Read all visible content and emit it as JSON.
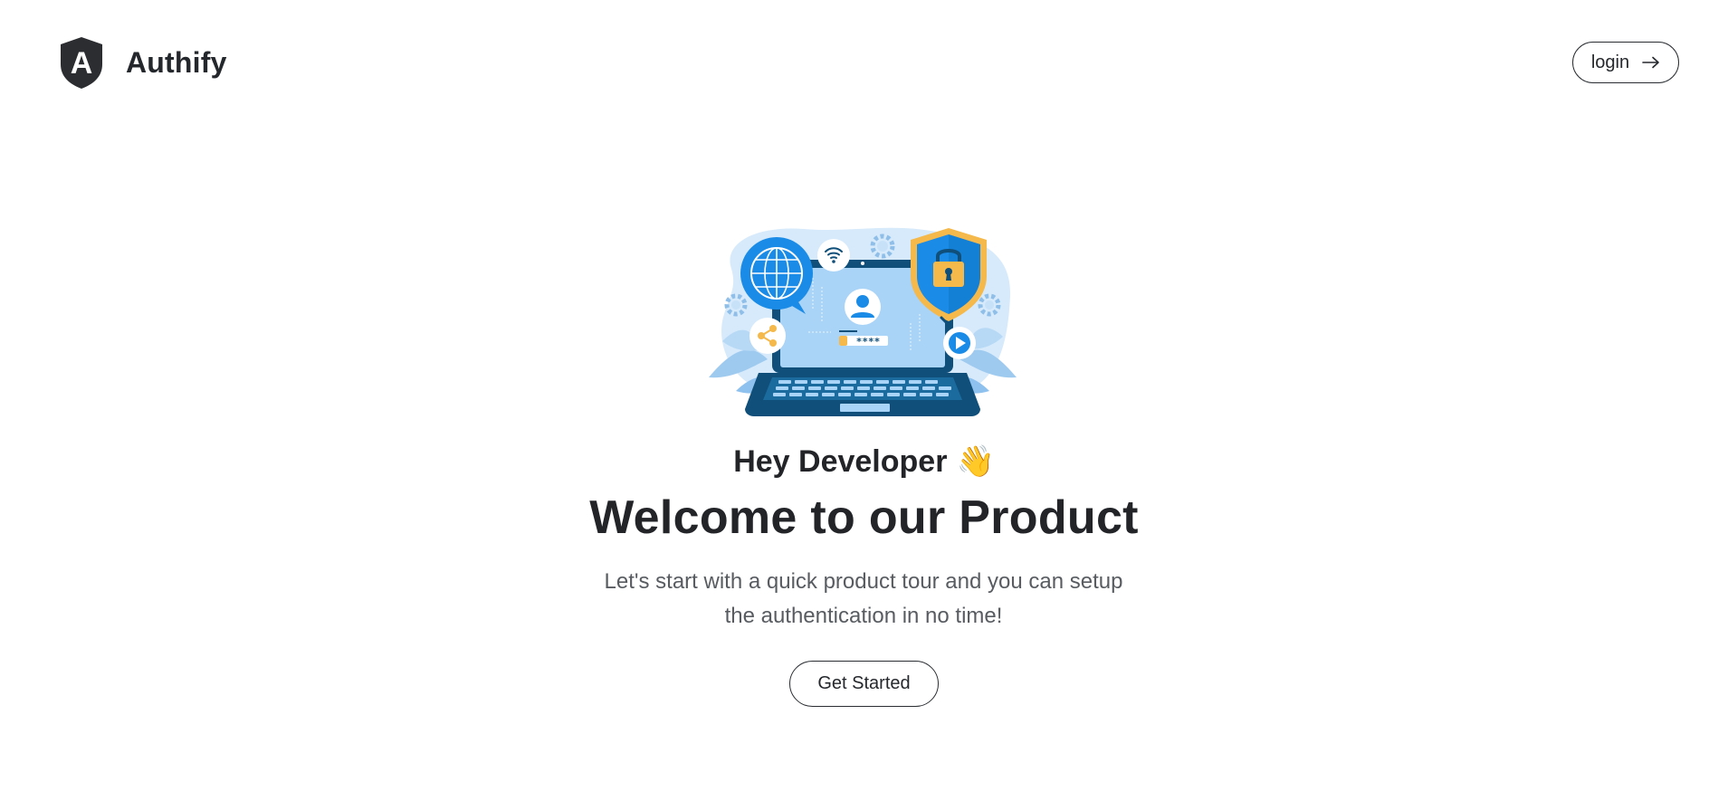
{
  "header": {
    "brand_name": "Authify",
    "logo_letter": "A",
    "login_label": "login"
  },
  "hero": {
    "greeting": "Hey Developer",
    "greeting_emoji": "👋",
    "headline": "Welcome to our Product",
    "subtext": "Let's start with a quick product tour and you can setup the authentication in no time!",
    "cta_label": "Get Started",
    "password_mask": "****"
  },
  "icons": {
    "logo": "shield-a-logo-icon",
    "login_arrow": "arrow-right-icon",
    "illustration": "laptop-security-illustration"
  },
  "colors": {
    "text_primary": "#222428",
    "text_secondary": "#585c61",
    "border": "#2a2d31",
    "brand_dark": "#2b2d30",
    "illustration_blue": "#1a8be6",
    "illustration_navy": "#0f4f7a",
    "illustration_light": "#a9d3f7",
    "lock_gold": "#f5b84a"
  }
}
